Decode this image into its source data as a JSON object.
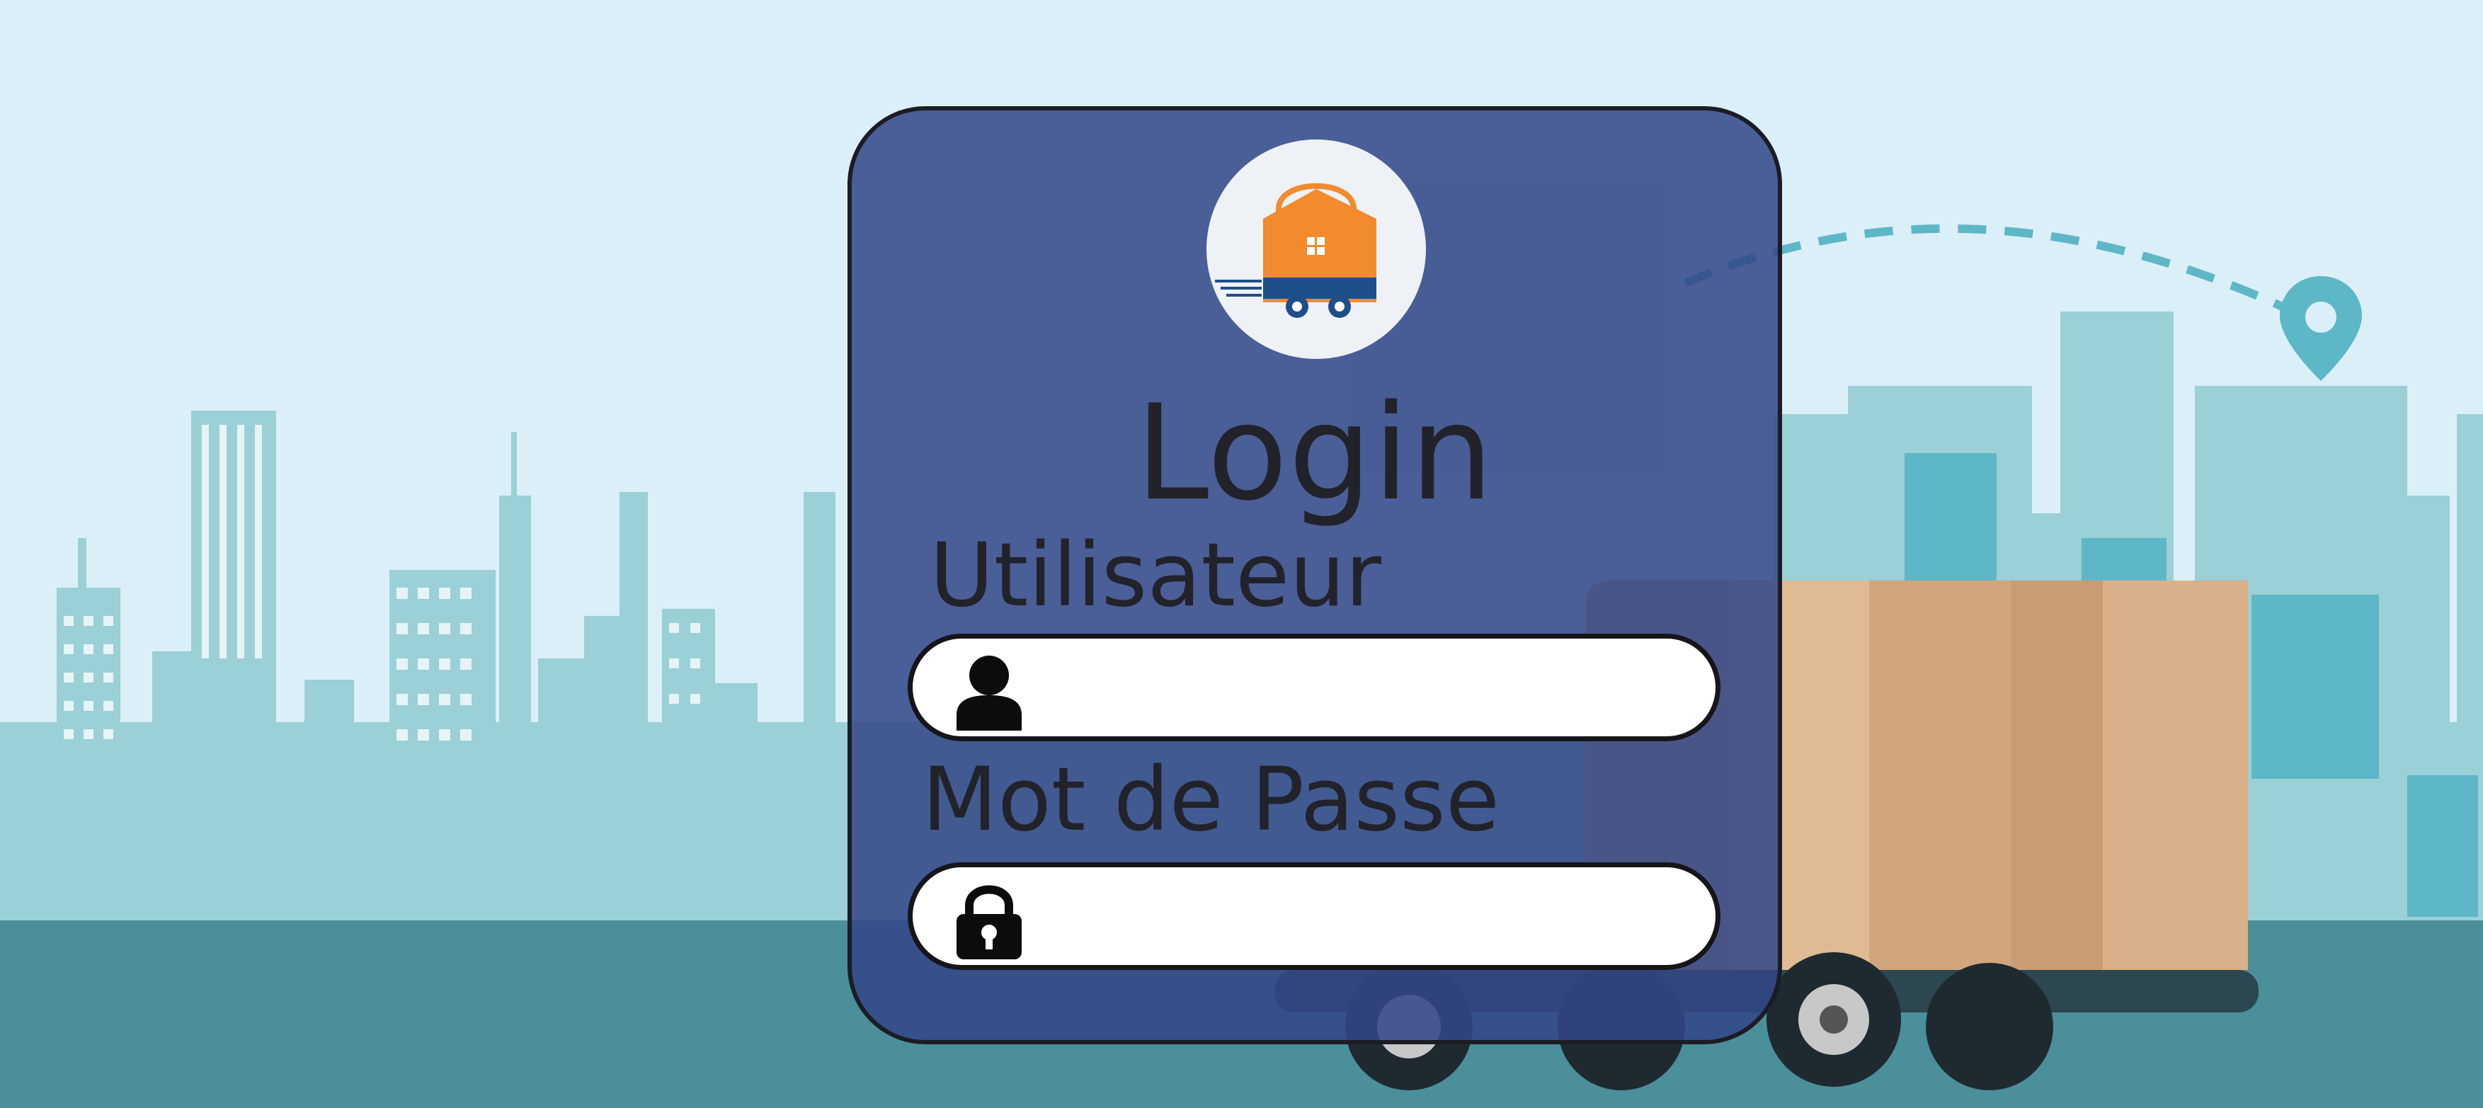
{
  "login": {
    "title": "Login",
    "username_label": "Utilisateur",
    "username_value": "",
    "password_label": "Mot de Passe",
    "password_value": ""
  },
  "icons": {
    "logo": "house-delivery-truck-logo-icon",
    "username": "user-icon",
    "password": "lock-icon"
  },
  "colors": {
    "panel": "#32468a",
    "logo_orange": "#f28a2e",
    "logo_navy": "#1e4f8a",
    "sky": "#dbeff8",
    "city": "#9ad0d6",
    "ground": "#4a8f9a"
  }
}
